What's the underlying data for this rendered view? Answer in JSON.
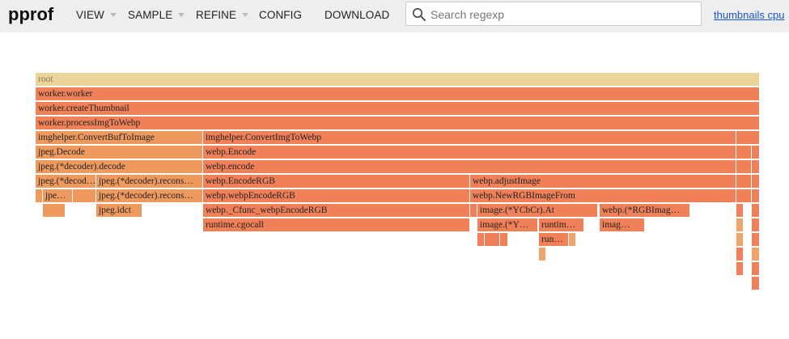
{
  "app": {
    "logo": "pprof"
  },
  "menu": [
    {
      "label": "VIEW",
      "dropdown": true
    },
    {
      "label": "SAMPLE",
      "dropdown": true
    },
    {
      "label": "REFINE",
      "dropdown": true
    },
    {
      "label": "CONFIG",
      "dropdown": false
    },
    {
      "label": "DOWNLOAD",
      "dropdown": false
    }
  ],
  "search": {
    "placeholder": "Search regexp",
    "value": "",
    "icon": "search-icon"
  },
  "link": {
    "label": "thumbnails cpu"
  },
  "colors": {
    "root": "#ead49a",
    "red": "#f08058",
    "orange": "#ee9a5e",
    "lightorange": "#f0a36a",
    "header": "#eeeeee",
    "link": "#1a55c9"
  },
  "flame": [
    {
      "l": "root",
      "c": "root"
    },
    {
      "l": "worker.worker",
      "c": "red"
    },
    {
      "l": "worker.createThumbnail",
      "c": "red"
    },
    {
      "l": "worker.processImgToWebp",
      "c": "red"
    },
    {
      "l": "imghelper.ConvertBufToImage",
      "c": "orange"
    },
    {
      "l": "imghelper.ConvertImgToWebp",
      "c": "red"
    },
    {
      "l": "",
      "c": "red"
    },
    {
      "l": "jpeg.Decode",
      "c": "orange"
    },
    {
      "l": "webp.Encode",
      "c": "red"
    },
    {
      "l": "",
      "c": "red"
    },
    {
      "l": "",
      "c": "red"
    },
    {
      "l": "jpeg.(*decoder).decode",
      "c": "orange"
    },
    {
      "l": "webp.encode",
      "c": "red"
    },
    {
      "l": "",
      "c": "red"
    },
    {
      "l": "",
      "c": "red"
    },
    {
      "l": "jpeg.(*decod…",
      "c": "orange"
    },
    {
      "l": "jpeg.(*decoder).recons…",
      "c": "orange"
    },
    {
      "l": "webp.EncodeRGB",
      "c": "red"
    },
    {
      "l": "webp.adjustImage",
      "c": "red"
    },
    {
      "l": "",
      "c": "red"
    },
    {
      "l": "",
      "c": "red"
    },
    {
      "l": "",
      "c": "orange"
    },
    {
      "l": "jpe…",
      "c": "orange"
    },
    {
      "l": "",
      "c": "orange"
    },
    {
      "l": "jpeg.(*decoder).recons…",
      "c": "orange"
    },
    {
      "l": "webp.webpEncodeRGB",
      "c": "red"
    },
    {
      "l": "webp.NewRGBImageFrom",
      "c": "red"
    },
    {
      "l": "",
      "c": "red"
    },
    {
      "l": "",
      "c": "red"
    },
    {
      "l": "",
      "c": "orange"
    },
    {
      "l": "jpeg.idct",
      "c": "orange"
    },
    {
      "l": "webp._Cfunc_webpEncodeRGB",
      "c": "red"
    },
    {
      "l": "",
      "c": "red"
    },
    {
      "l": "image.(*YCbCr).At",
      "c": "red"
    },
    {
      "l": "webp.(*RGBImag…",
      "c": "red"
    },
    {
      "l": "",
      "c": "red"
    },
    {
      "l": "",
      "c": "red"
    },
    {
      "l": "runtime.cgocall",
      "c": "red"
    },
    {
      "l": "image.(*Y…",
      "c": "red"
    },
    {
      "l": "runtim…",
      "c": "red"
    },
    {
      "l": "imag…",
      "c": "red"
    },
    {
      "l": "",
      "c": "red"
    },
    {
      "l": "",
      "c": "lightorange"
    },
    {
      "l": "",
      "c": "red"
    },
    {
      "l": "",
      "c": "red"
    },
    {
      "l": "",
      "c": "red"
    },
    {
      "l": "",
      "c": "red"
    },
    {
      "l": "run…",
      "c": "red"
    },
    {
      "l": "",
      "c": "lightorange"
    },
    {
      "l": "",
      "c": "lightorange"
    },
    {
      "l": "",
      "c": "red"
    },
    {
      "l": "",
      "c": "lightorange"
    },
    {
      "l": "",
      "c": "red"
    },
    {
      "l": "",
      "c": "lightorange"
    },
    {
      "l": "",
      "c": "red"
    },
    {
      "l": "",
      "c": "red"
    },
    {
      "l": "",
      "c": "red"
    }
  ]
}
